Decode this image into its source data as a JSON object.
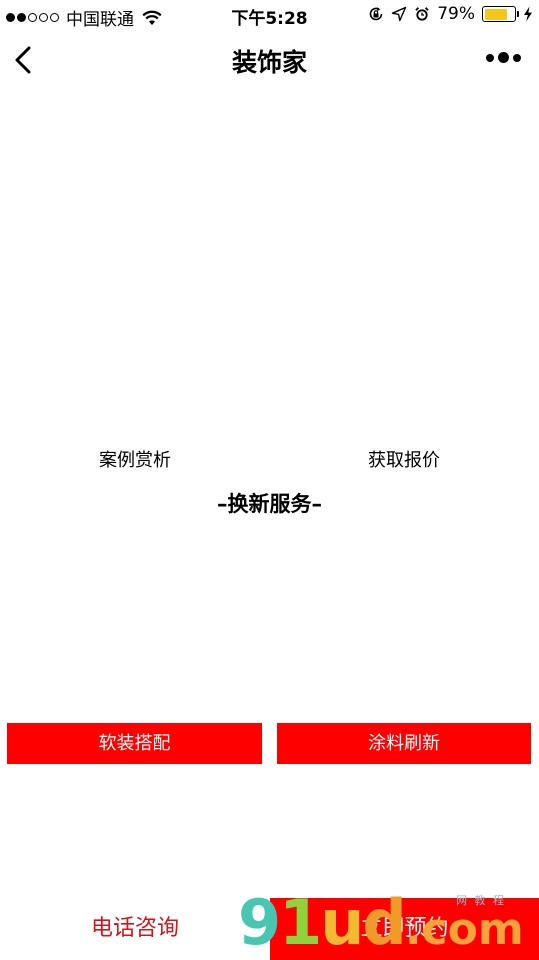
{
  "status_bar": {
    "carrier": "中国联通",
    "time": "下午5:28",
    "battery_percent": "79%",
    "battery_level": 0.79,
    "icons": [
      "signal-dots-icon",
      "wifi-icon",
      "rotation-lock-icon",
      "location-arrow-icon",
      "alarm-icon",
      "battery-icon",
      "charging-bolt-icon"
    ]
  },
  "nav": {
    "title": "装饰家",
    "back_icon": "chevron-left-icon",
    "more_icon": "more-dots-icon"
  },
  "links": {
    "left": "案例赏析",
    "right": "获取报价"
  },
  "section": {
    "title": "–换新服务–"
  },
  "service_buttons": {
    "left": "软装搭配",
    "right": "涂料刷新"
  },
  "bottom_bar": {
    "phone": "电话咨询",
    "book": "立即预约"
  },
  "watermark": {
    "logo": "91ud.com",
    "small_text": "网 教 程"
  },
  "colors": {
    "accent_red": "#fe0000",
    "phone_text_red": "#d4141a",
    "battery_yellow": "#f5c518"
  }
}
